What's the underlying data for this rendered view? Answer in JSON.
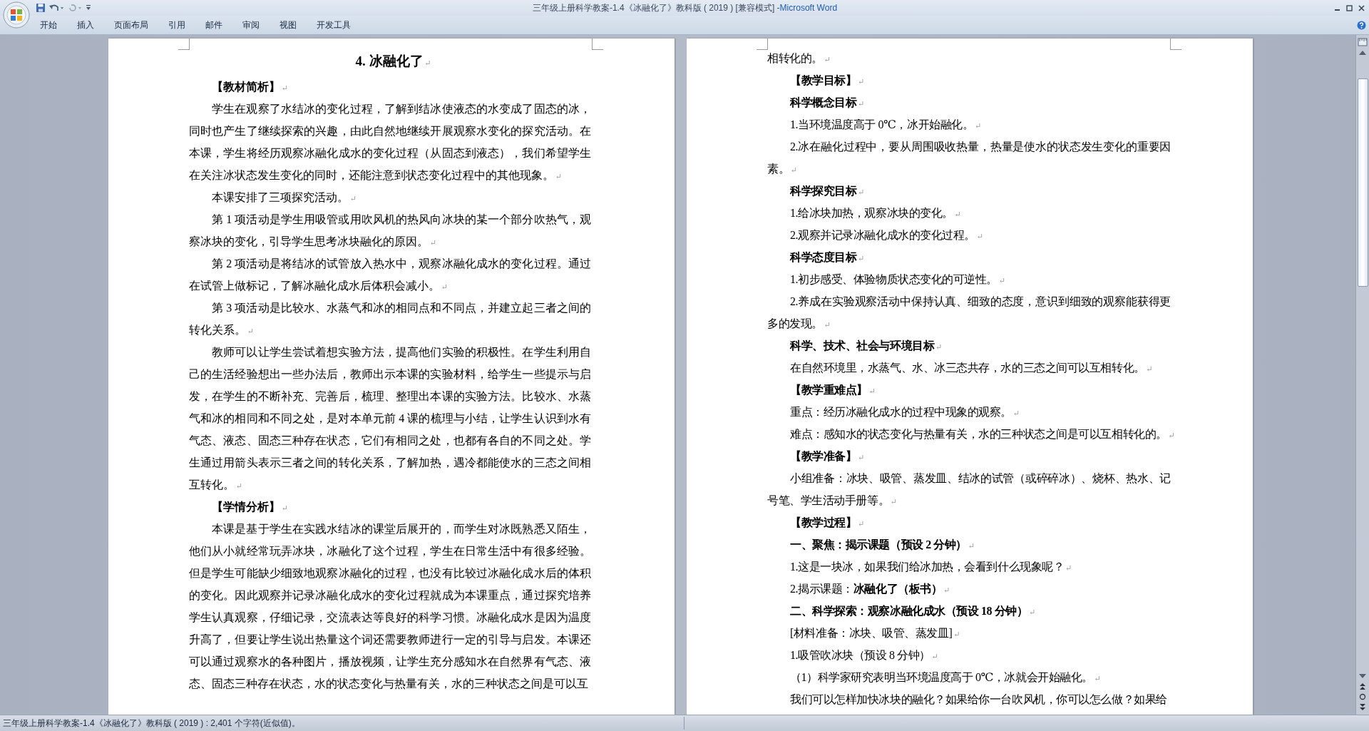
{
  "window": {
    "document_title": "三年级上册科学教案-1.4《冰融化了》教科版 ( 2019 ) [兼容模式]",
    "separator": "-",
    "app_name": "Microsoft Word"
  },
  "ribbon_tabs": [
    {
      "label": "开始"
    },
    {
      "label": "插入"
    },
    {
      "label": "页面布局"
    },
    {
      "label": "引用"
    },
    {
      "label": "邮件"
    },
    {
      "label": "审阅"
    },
    {
      "label": "视图"
    },
    {
      "label": "开发工具"
    }
  ],
  "pages": [
    {
      "paragraphs": [
        {
          "kind": "title",
          "text": "4. 冰融化了",
          "end_mark": "↵"
        },
        {
          "kind": "heading",
          "text": "【教材简析】",
          "end_mark": "↵"
        },
        {
          "kind": "body",
          "text": "学生在观察了水结冰的变化过程，了解到结冰使液态的水变成了固态的冰，同时也产生了继续探索的兴趣，由此自然地继续开展观察水变化的探究活动。在本课，学生将经历观察冰融化成水的变化过程（从固态到液态），我们希望学生在关注冰状态发生变化的同时，还能注意到状态变化过程中的其他现象。",
          "end_mark": "↵"
        },
        {
          "kind": "body",
          "text": "本课安排了三项探究活动。",
          "end_mark": "↵"
        },
        {
          "kind": "body",
          "text": "第 1 项活动是学生用吸管或用吹风机的热风向冰块的某一个部分吹热气，观察冰块的变化，引导学生思考冰块融化的原因。",
          "end_mark": "↵"
        },
        {
          "kind": "body",
          "text": "第 2 项活动是将结冰的试管放入热水中，观察冰融化成水的变化过程。通过在试管上做标记，了解冰融化成水后体积会减小。",
          "end_mark": "↵"
        },
        {
          "kind": "body",
          "text": "第 3 项活动是比较水、水蒸气和冰的相同点和不同点，并建立起三者之间的转化关系。",
          "end_mark": "↵"
        },
        {
          "kind": "body",
          "text": "教师可以让学生尝试着想实验方法，提高他们实验的积极性。在学生利用自己的生活经验想出一些办法后，教师出示本课的实验材料，给学生一些提示与启发，在学生的不断补充、完善后，梳理、整理出本课的实验方法。比较水、水蒸气和冰的相同和不同之处，是对本单元前 4 课的梳理与小结，让学生认识到水有气态、液态、固态三种存在状态，它们有相同之处，也都有各自的不同之处。学生通过用箭头表示三者之间的转化关系，了解加热，遇冷都能使水的三态之间相互转化。",
          "end_mark": "↵"
        },
        {
          "kind": "heading",
          "text": "【学情分析】",
          "end_mark": "↵"
        },
        {
          "kind": "body",
          "text": "本课是基于学生在实践水结冰的课堂后展开的，而学生对冰既熟悉又陌生，他们从小就经常玩弄冰块，冰融化了这个过程，学生在日常生活中有很多经验。但是学生可能缺少细致地观察冰融化的过程，也没有比较过冰融化成水后的体积的变化。因此观察并记录冰融化成水的变化过程就成为本课重点，通过探究培养学生认真观察，仔细记录，交流表达等良好的科学习惯。冰融化成水是因为温度升高了，但要让学生说出热量这个词还需要教师进行一定的引导与启发。本课还可以通过观察水的各种图片，播放视频，让学生充分感知水在自然界有气态、液态、固态三种存在状态，水的状态变化与热量有关，水的三种状态之间是可以互"
        }
      ]
    },
    {
      "paragraphs": [
        {
          "kind": "continued",
          "text": "相转化的。",
          "end_mark": "↵"
        },
        {
          "kind": "heading",
          "text": "【教学目标】",
          "end_mark": "↵"
        },
        {
          "kind": "heading",
          "text": "科学概念目标",
          "end_mark": "↵"
        },
        {
          "kind": "body",
          "text": "1.当环境温度高于 0℃，冰开始融化。",
          "end_mark": "↵"
        },
        {
          "kind": "body",
          "text": "2.冰在融化过程中，要从周围吸收热量，热量是使水的状态发生变化的重要因素。",
          "end_mark": "↵"
        },
        {
          "kind": "heading",
          "text": "科学探究目标",
          "end_mark": "↵"
        },
        {
          "kind": "body",
          "text": "1.给冰块加热，观察冰块的变化。",
          "end_mark": "↵"
        },
        {
          "kind": "body",
          "text": "2.观察并记录冰融化成水的变化过程。",
          "end_mark": "↵"
        },
        {
          "kind": "heading",
          "text": "科学态度目标",
          "end_mark": "↵"
        },
        {
          "kind": "body",
          "text": "1.初步感受、体验物质状态变化的可逆性。",
          "end_mark": "↵"
        },
        {
          "kind": "body",
          "text": "2.养成在实验观察活动中保持认真、细致的态度，意识到细致的观察能获得更多的发现。",
          "end_mark": "↵"
        },
        {
          "kind": "heading",
          "text": "科学、技术、社会与环境目标",
          "end_mark": "↵"
        },
        {
          "kind": "body",
          "text": "在自然环境里，水蒸气、水、冰三态共存，水的三态之间可以互相转化。",
          "end_mark": "↵"
        },
        {
          "kind": "heading",
          "text": "【教学重难点】",
          "end_mark": "↵"
        },
        {
          "kind": "body",
          "text": "重点：经历冰融化成水的过程中现象的观察。",
          "end_mark": "↵"
        },
        {
          "kind": "body",
          "text": "难点：感知水的状态变化与热量有关，水的三种状态之间是可以互相转化的。",
          "end_mark": "↵"
        },
        {
          "kind": "heading",
          "text": "【教学准备】",
          "end_mark": "↵"
        },
        {
          "kind": "body",
          "text": "小组准备：冰块、吸管、蒸发皿、结冰的试管（或碎碎冰）、烧杯、热水、记号笔、学生活动手册等。",
          "end_mark": "↵"
        },
        {
          "kind": "heading",
          "text": "【教学过程】",
          "end_mark": "↵"
        },
        {
          "kind": "heading",
          "text": "一、聚焦：揭示课题（预设 2 分钟）",
          "end_mark": "↵"
        },
        {
          "kind": "body",
          "text": "1.这是一块冰，如果我们给冰加热，会看到什么现象呢？",
          "end_mark": "↵"
        },
        {
          "kind": "body",
          "text": "2.揭示课题：**冰融化了（板书）**",
          "end_mark": "↵"
        },
        {
          "kind": "heading",
          "text": "二、科学探索：观察冰融化成水（预设 18 分钟）",
          "end_mark": "↵"
        },
        {
          "kind": "body",
          "text": " [材料准备：冰块、吸管、蒸发皿]",
          "end_mark": "↵"
        },
        {
          "kind": "body",
          "text": "1.吸管吹冰块（预设 8 分钟）",
          "end_mark": "↵"
        },
        {
          "kind": "body",
          "text": " （1）科学家研究表明当环境温度高于 0℃，冰就会开始融化。",
          "end_mark": "↵"
        },
        {
          "kind": "body",
          "text": "我们可以怎样加快冰块的融化？如果给你一台吹风机，你可以怎么做？如果给"
        }
      ]
    }
  ],
  "status_bar": {
    "text": "三年级上册科学教案-1.4《冰融化了》教科版 ( 2019 ) : 2,401 个字符(近似值)。"
  }
}
